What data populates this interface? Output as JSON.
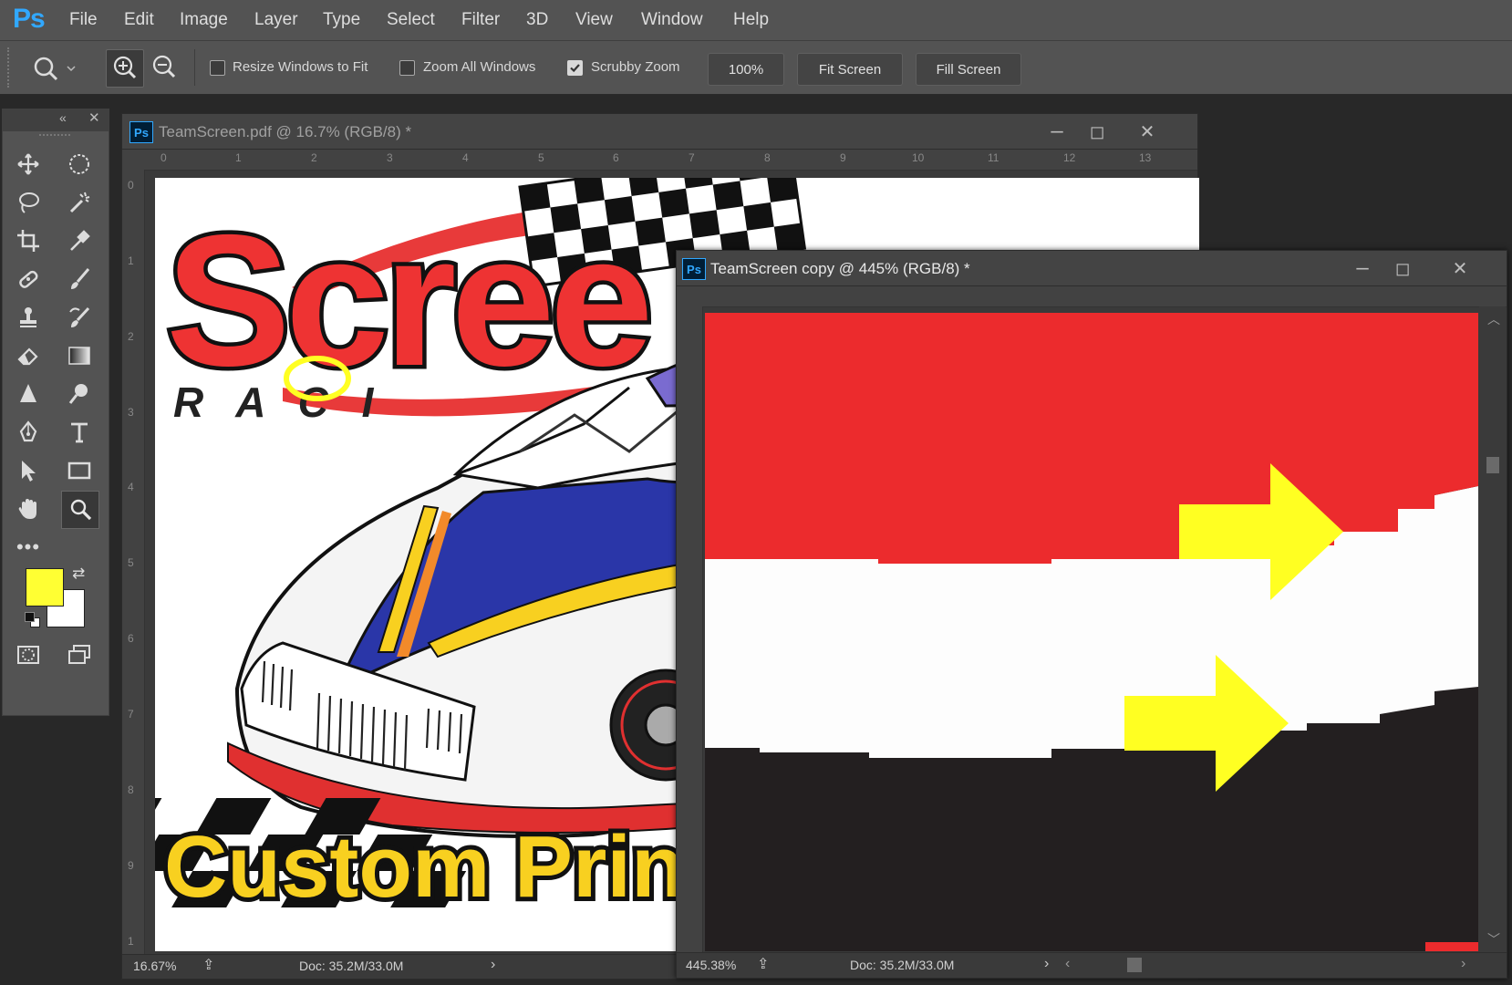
{
  "app": {
    "logo": "Ps"
  },
  "menu": [
    "File",
    "Edit",
    "Image",
    "Layer",
    "Type",
    "Select",
    "Filter",
    "3D",
    "View",
    "Window",
    "Help"
  ],
  "options": {
    "resize_windows": {
      "label": "Resize Windows to Fit",
      "checked": false
    },
    "zoom_all": {
      "label": "Zoom All Windows",
      "checked": false
    },
    "scrubby_zoom": {
      "label": "Scrubby Zoom",
      "checked": true
    },
    "zoom_100": "100%",
    "fit_screen": "Fit Screen",
    "fill_screen": "Fill Screen"
  },
  "colors": {
    "foreground": "#ffff33",
    "background": "#ffffff",
    "accent": "#31a8ff"
  },
  "doc1": {
    "title": "TeamScreen.pdf @ 16.7% (RGB/8) *",
    "zoom": "16.67%",
    "doc_size": "Doc: 35.2M/33.0M",
    "ruler_top": [
      "0",
      "1",
      "2",
      "3",
      "4",
      "5",
      "6",
      "7",
      "8",
      "9",
      "10",
      "11",
      "12",
      "13"
    ],
    "ruler_left": [
      "0",
      "1",
      "2",
      "3",
      "4",
      "5",
      "6",
      "7",
      "8",
      "9",
      "1"
    ],
    "artwork": {
      "logo_text": "Scree",
      "racing_text": "R A C I",
      "custom_text": "Custom Prin"
    }
  },
  "doc2": {
    "title": "TeamScreen copy @ 445% (RGB/8) *",
    "zoom": "445.38%",
    "doc_size": "Doc: 35.2M/33.0M"
  }
}
